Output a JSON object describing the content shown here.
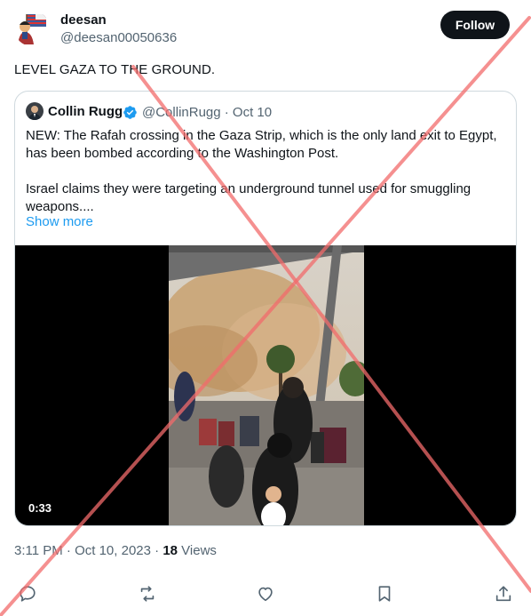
{
  "author": {
    "name": "deesan",
    "handle": "@deesan00050636",
    "avatar_icon": "cartoon-character-flag-avatar"
  },
  "follow_button": {
    "label": "Follow"
  },
  "tweet_text": "LEVEL GAZA TO THE GROUND.",
  "quote": {
    "name": "Collin Rugg",
    "verified_icon": "verified-badge-icon",
    "handle_date": "@CollinRugg · Oct 10",
    "paragraph_1": "NEW: The Rafah crossing in the Gaza Strip, which is the only land exit to Egypt, has been bombed according to the Washington Post.",
    "paragraph_2": "Israel claims they were targeting an underground tunnel used for smuggling weapons....",
    "show_more": "Show more",
    "video_duration": "0:33"
  },
  "meta": {
    "time_date": "3:11 PM · Oct 10, 2023 · ",
    "views_count": "18",
    "views_label": " Views"
  },
  "actions": [
    "reply-icon",
    "retweet-icon",
    "like-icon",
    "bookmark-icon",
    "share-icon"
  ],
  "colors": {
    "accent": "#1d9bf0",
    "text": "#0f1419",
    "secondary": "#536471",
    "overlay_x": "#f26b6b"
  }
}
